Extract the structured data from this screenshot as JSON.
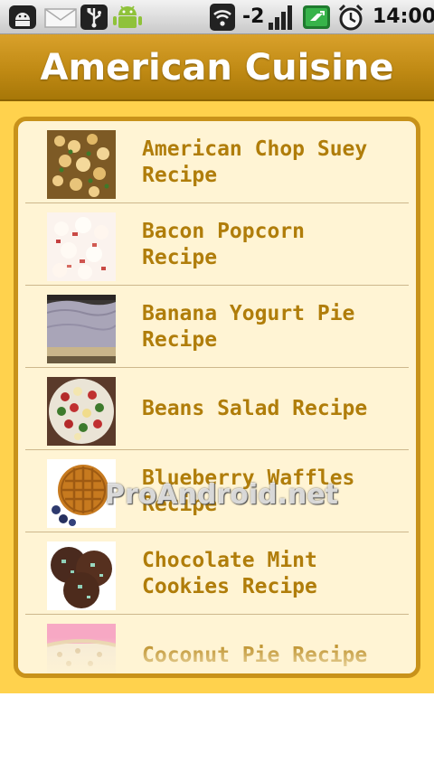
{
  "status_bar": {
    "signal_label": "-2",
    "time": "14:00",
    "icons": [
      "android-icon",
      "mail-icon",
      "usb-icon",
      "debug-android-icon",
      "wifi-icon",
      "signal-icon",
      "battery-icon",
      "alarm-icon"
    ]
  },
  "title_bar": {
    "title": "American Cuisine"
  },
  "list": {
    "items": [
      {
        "label": "American Chop Suey\nRecipe",
        "thumb": "chop-suey-image"
      },
      {
        "label": "Bacon Popcorn\nRecipe",
        "thumb": "bacon-popcorn-image"
      },
      {
        "label": "Banana Yogurt Pie\nRecipe",
        "thumb": "banana-yogurt-pie-image"
      },
      {
        "label": "Beans Salad Recipe",
        "thumb": "beans-salad-image"
      },
      {
        "label": "Blueberry Waffles\nRecipe",
        "thumb": "blueberry-waffles-image"
      },
      {
        "label": "Chocolate Mint\nCookies Recipe",
        "thumb": "chocolate-mint-cookies-image"
      },
      {
        "label": "Coconut Pie Recipe",
        "thumb": "coconut-pie-image"
      }
    ]
  },
  "watermark": "ProAndroid.net",
  "colors": {
    "title_bar": "#c08a14",
    "content_bg": "#ffd24d",
    "list_bg": "#fff4d4",
    "list_border": "#c8921a",
    "item_text": "#b07d0a"
  }
}
